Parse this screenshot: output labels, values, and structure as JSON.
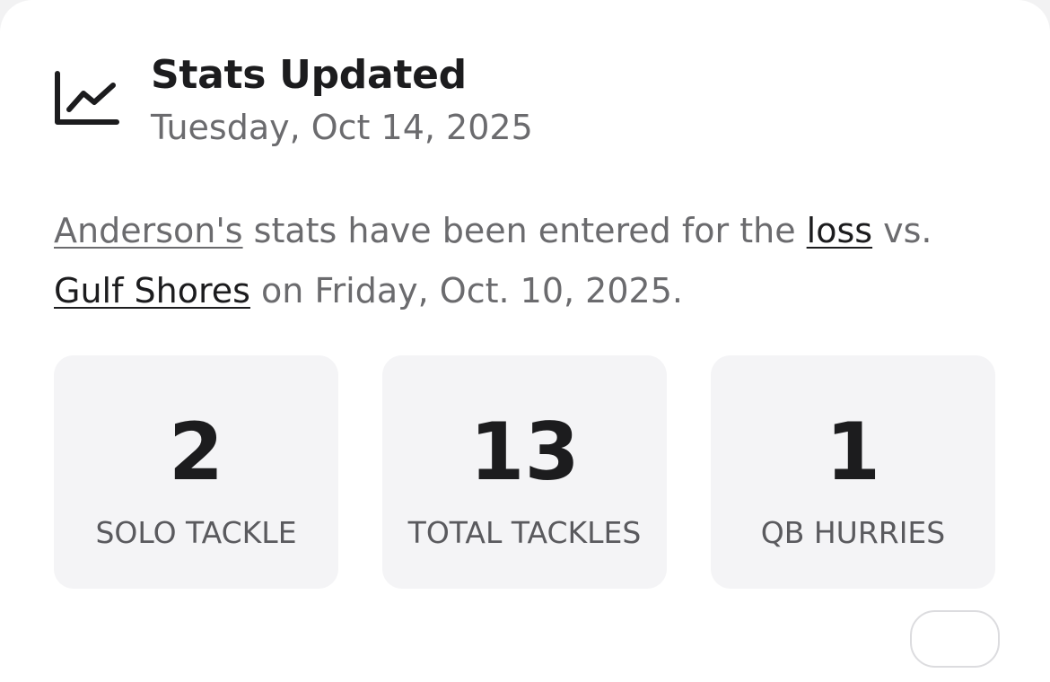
{
  "notification": {
    "title": "Stats Updated",
    "date": "Tuesday, Oct 14, 2025",
    "icon": "line-chart-icon"
  },
  "message": {
    "player_link": "Anderson's",
    "text_1": " stats have been entered for the ",
    "result_link": "loss",
    "text_2": " vs. ",
    "opponent_link": "Gulf Shores",
    "text_3": " on Friday, Oct. 10, 2025."
  },
  "stats": [
    {
      "value": "2",
      "label": "SOLO TACKLE"
    },
    {
      "value": "13",
      "label": "TOTAL TACKLES"
    },
    {
      "value": "1",
      "label": "QB HURRIES"
    }
  ],
  "colors": {
    "title": "#1c1c1e",
    "muted_text": "#6b6b6e",
    "stat_background": "#f4f4f6"
  }
}
